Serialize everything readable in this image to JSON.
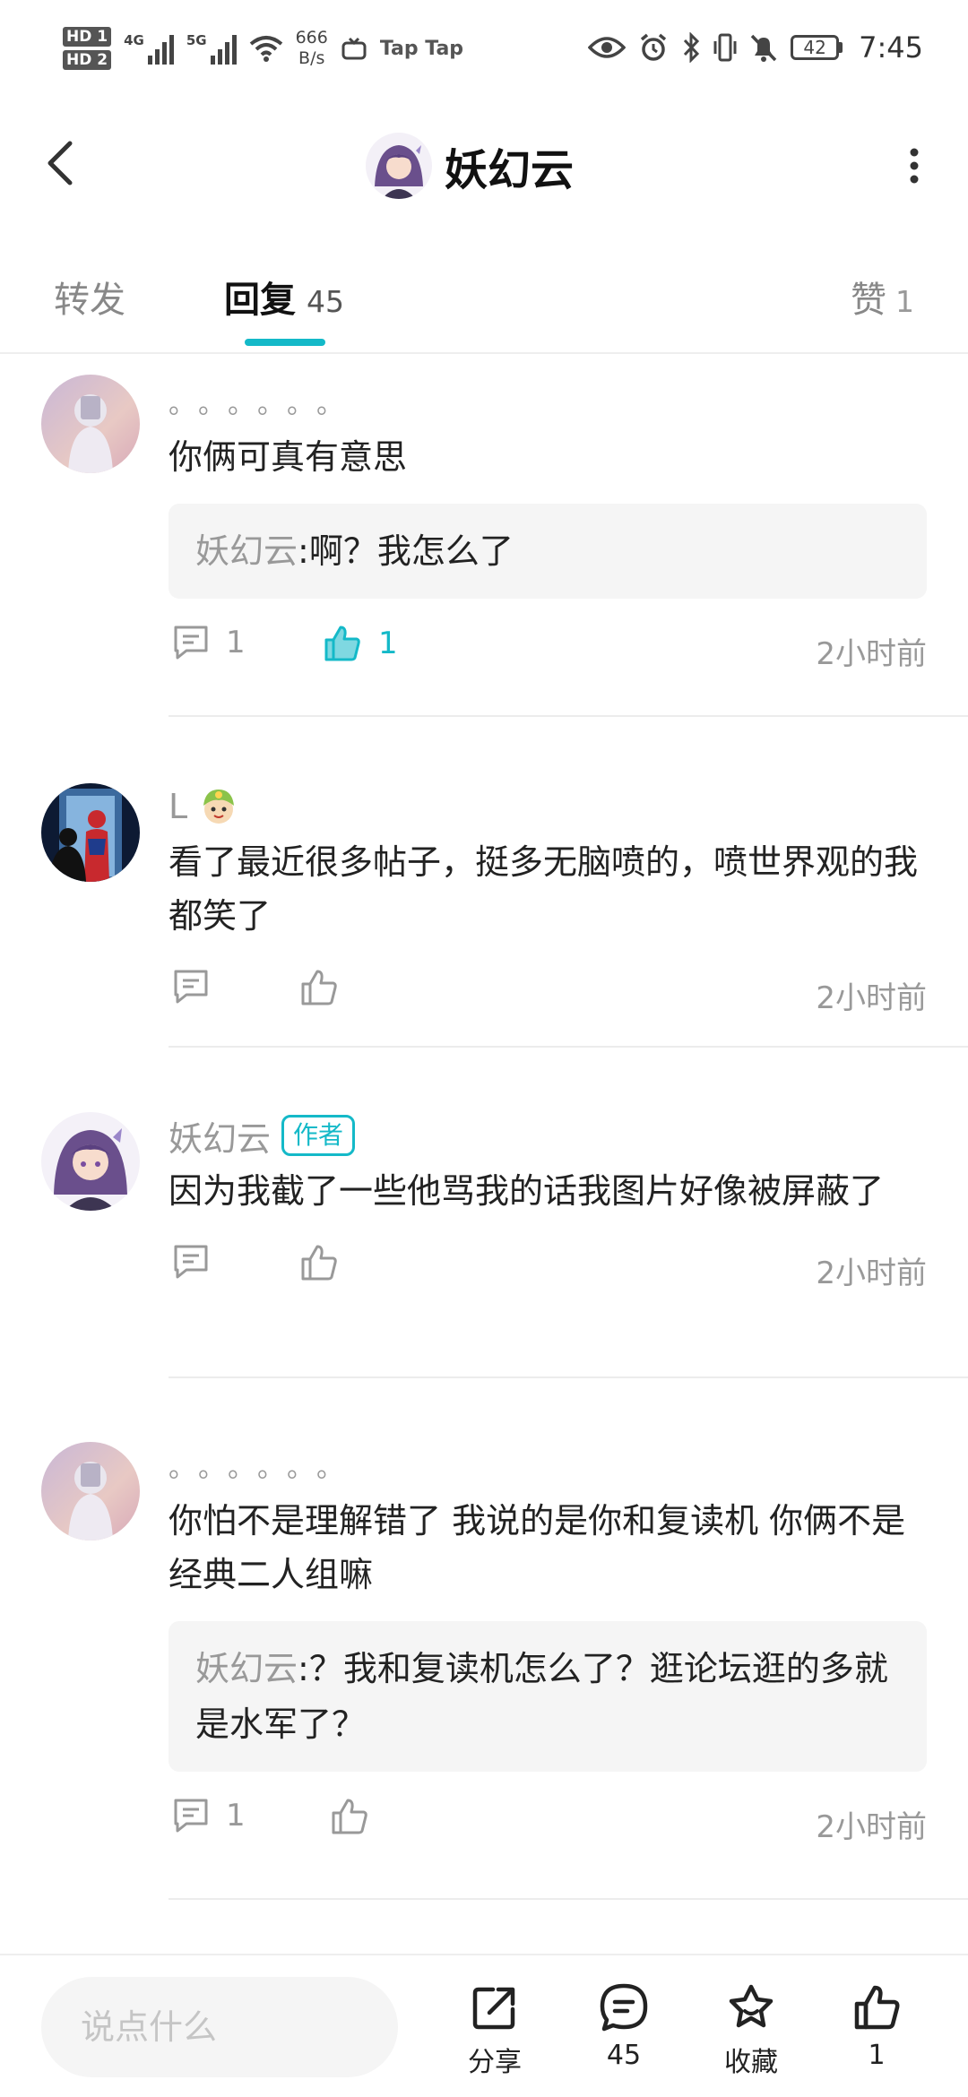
{
  "status_bar": {
    "hd1": "HD 1",
    "hd2": "HD 2",
    "sig1": "4G",
    "sig2": "5G",
    "net_speed_value": "666",
    "net_speed_unit": "B/s",
    "app_label": "Tap Tap",
    "battery": "42",
    "time": "7:45"
  },
  "nav": {
    "title": "妖幻云"
  },
  "tabs": {
    "forward": "转发",
    "reply": "回复",
    "reply_count": "45",
    "like": "赞",
    "like_count": "1"
  },
  "comments": [
    {
      "name": "。。。。。。",
      "text": "你俩可真有意思",
      "quote_name": "妖幻云",
      "quote_text": ":啊？我怎么了",
      "reply_count": "1",
      "like_count": "1",
      "liked": true,
      "time": "2小时前"
    },
    {
      "name": "L",
      "text": "看了最近很多帖子，挺多无脑喷的，喷世界观的我都笑了",
      "time": "2小时前"
    },
    {
      "name": "妖幻云",
      "badge": "作者",
      "text": "因为我截了一些他骂我的话我图片好像被屏蔽了",
      "time": "2小时前"
    },
    {
      "name": "。。。。。。",
      "text": "你怕不是理解错了 我说的是你和复读机 你俩不是经典二人组嘛",
      "quote_name": "妖幻云",
      "quote_text": ":？我和复读机怎么了？逛论坛逛的多就是水军了？",
      "reply_count": "1",
      "time": "2小时前"
    }
  ],
  "bottom_bar": {
    "input_placeholder": "说点什么",
    "share": "分享",
    "comments": "45",
    "favorite": "收藏",
    "likes": "1"
  },
  "colors": {
    "accent": "#14b9c8",
    "muted_text": "#999999"
  }
}
